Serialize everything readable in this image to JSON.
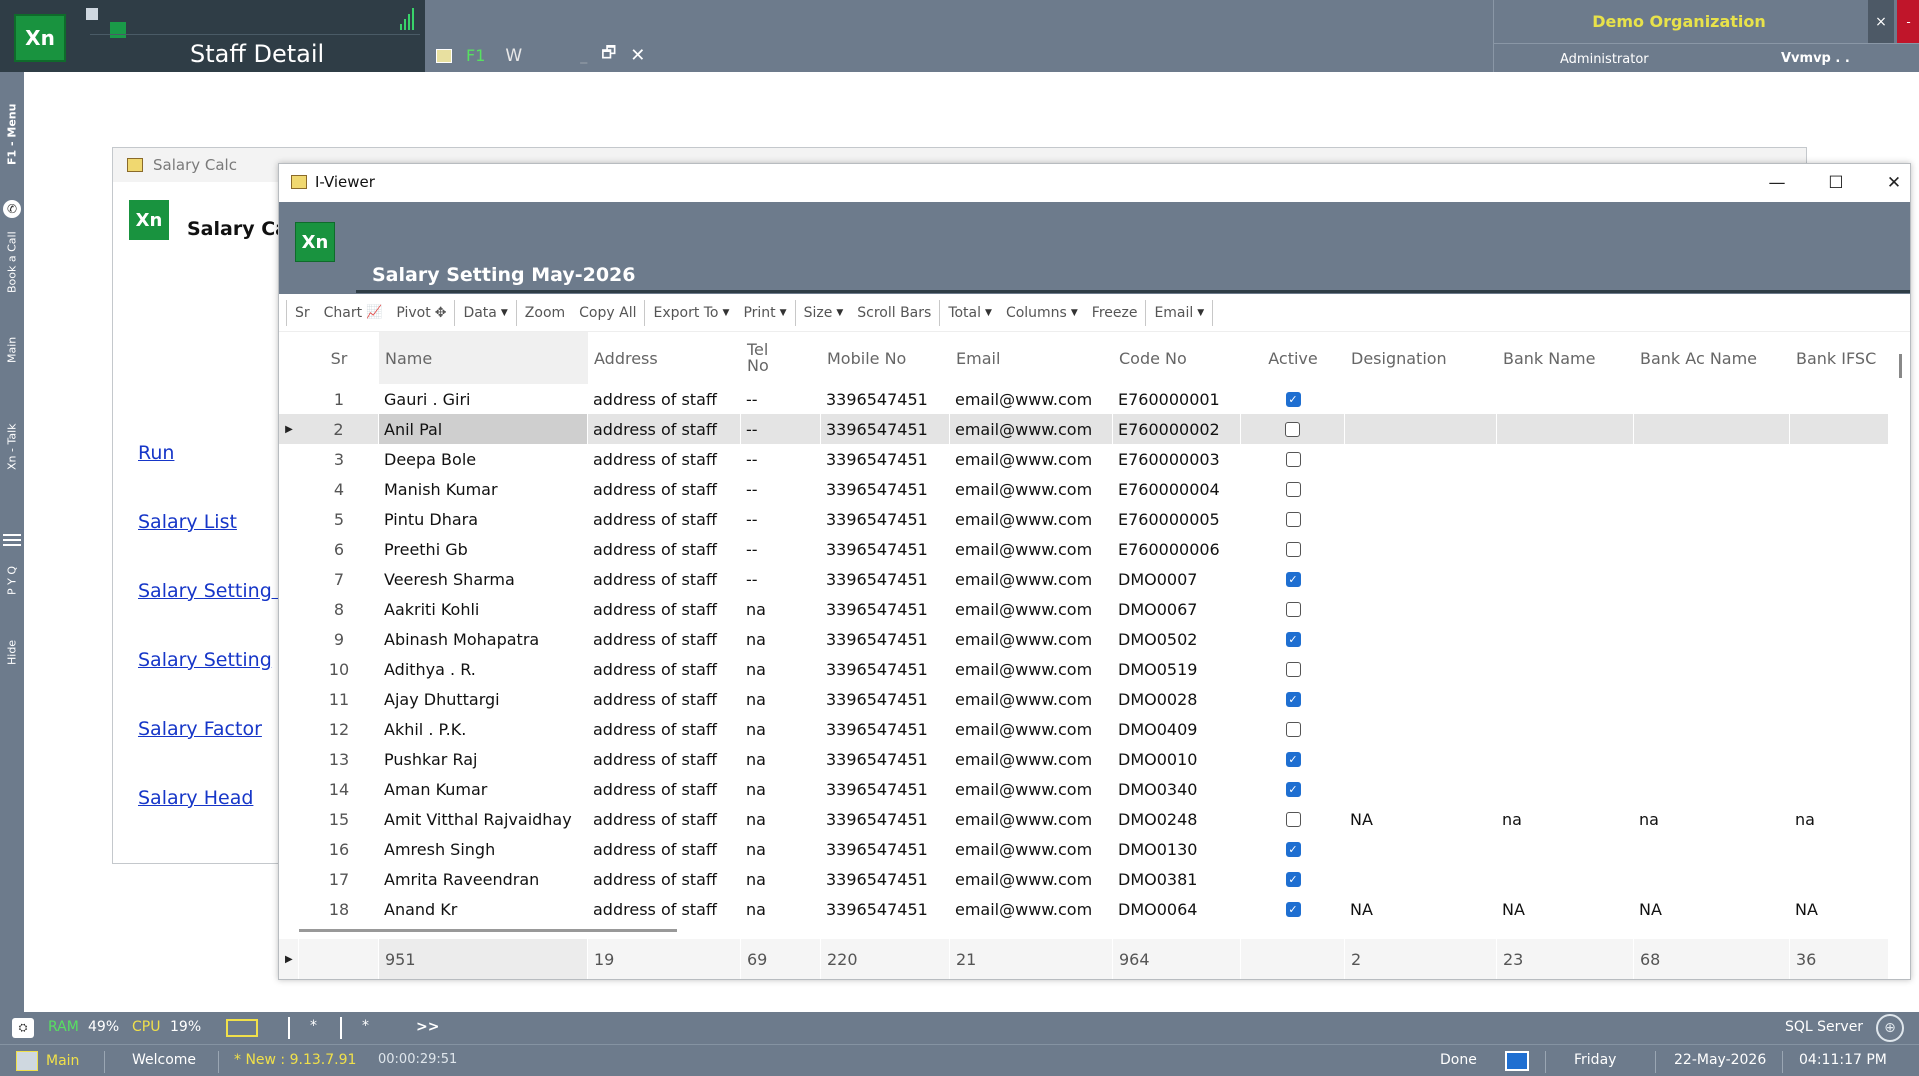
{
  "app": {
    "logo": "Xn",
    "title": "Staff Detail",
    "f1_label": "F1",
    "w_label": "W",
    "min_glyph": "_",
    "restore_glyph": "🗗",
    "close_glyph": "✕",
    "organization": "Demo Organization",
    "user_role": "Administrator",
    "user_name": "Vvmvp . .",
    "org_close": "×",
    "org_red": "-"
  },
  "left_rail": {
    "items": [
      "F1 - Menu",
      "Book a Call",
      "Main",
      "Xn - Talk",
      "P Y Q",
      "Hide"
    ]
  },
  "salary_calc": {
    "window_title": "Salary Calc",
    "logo": "Xn",
    "heading": "Salary Calc",
    "links": [
      "Run",
      "Salary List",
      "Salary Setting L",
      "Salary Setting",
      "Salary Factor",
      "Salary Head"
    ]
  },
  "viewer": {
    "window_title": "I-Viewer",
    "min_glyph": "—",
    "max_glyph": "☐",
    "close_glyph": "✕",
    "logo": "Xn",
    "heading": "Salary Setting May-2026",
    "toolbar": {
      "sr": "Sr",
      "chart": "Chart",
      "pivot": "Pivot",
      "data": "Data",
      "zoom": "Zoom",
      "copy_all": "Copy All",
      "export_to": "Export To",
      "print": "Print",
      "size": "Size",
      "scroll_bars": "Scroll Bars",
      "total": "Total",
      "columns": "Columns",
      "freeze": "Freeze",
      "email": "Email"
    },
    "columns": [
      "Sr",
      "Name",
      "Address",
      "Tel No",
      "Mobile No",
      "Email",
      "Code No",
      "Active",
      "Designation",
      "Bank Name",
      "Bank Ac Name",
      "Bank IFSC"
    ],
    "rows": [
      {
        "sr": "1",
        "name": "Gauri . Giri",
        "address": "address of staff",
        "tel": "--",
        "mobile": "3396547451",
        "email": "email@www.com",
        "code": "E760000001",
        "active": true,
        "designation": "",
        "bank": "",
        "acname": "",
        "ifsc": ""
      },
      {
        "sr": "2",
        "name": "Anil Pal",
        "address": "address of staff",
        "tel": "--",
        "mobile": "3396547451",
        "email": "email@www.com",
        "code": "E760000002",
        "active": false,
        "designation": "",
        "bank": "",
        "acname": "",
        "ifsc": ""
      },
      {
        "sr": "3",
        "name": "Deepa Bole",
        "address": "address of staff",
        "tel": "--",
        "mobile": "3396547451",
        "email": "email@www.com",
        "code": "E760000003",
        "active": false,
        "designation": "",
        "bank": "",
        "acname": "",
        "ifsc": ""
      },
      {
        "sr": "4",
        "name": "Manish Kumar",
        "address": "address of staff",
        "tel": "--",
        "mobile": "3396547451",
        "email": "email@www.com",
        "code": "E760000004",
        "active": false,
        "designation": "",
        "bank": "",
        "acname": "",
        "ifsc": ""
      },
      {
        "sr": "5",
        "name": "Pintu Dhara",
        "address": "address of staff",
        "tel": "--",
        "mobile": "3396547451",
        "email": "email@www.com",
        "code": "E760000005",
        "active": false,
        "designation": "",
        "bank": "",
        "acname": "",
        "ifsc": ""
      },
      {
        "sr": "6",
        "name": "Preethi Gb",
        "address": "address of staff",
        "tel": "--",
        "mobile": "3396547451",
        "email": "email@www.com",
        "code": "E760000006",
        "active": false,
        "designation": "",
        "bank": "",
        "acname": "",
        "ifsc": ""
      },
      {
        "sr": "7",
        "name": "Veeresh Sharma",
        "address": "address of staff",
        "tel": "--",
        "mobile": "3396547451",
        "email": "email@www.com",
        "code": "DMO0007",
        "active": true,
        "designation": "",
        "bank": "",
        "acname": "",
        "ifsc": ""
      },
      {
        "sr": "8",
        "name": "Aakriti Kohli",
        "address": "address of staff",
        "tel": "na",
        "mobile": "3396547451",
        "email": "email@www.com",
        "code": "DMO0067",
        "active": false,
        "designation": "",
        "bank": "",
        "acname": "",
        "ifsc": ""
      },
      {
        "sr": "9",
        "name": "Abinash Mohapatra",
        "address": "address of staff",
        "tel": "na",
        "mobile": "3396547451",
        "email": "email@www.com",
        "code": "DMO0502",
        "active": true,
        "designation": "",
        "bank": "",
        "acname": "",
        "ifsc": ""
      },
      {
        "sr": "10",
        "name": "Adithya . R.",
        "address": "address of staff",
        "tel": "na",
        "mobile": "3396547451",
        "email": "email@www.com",
        "code": "DMO0519",
        "active": false,
        "designation": "",
        "bank": "",
        "acname": "",
        "ifsc": ""
      },
      {
        "sr": "11",
        "name": "Ajay Dhuttargi",
        "address": "address of staff",
        "tel": "na",
        "mobile": "3396547451",
        "email": "email@www.com",
        "code": "DMO0028",
        "active": true,
        "designation": "",
        "bank": "",
        "acname": "",
        "ifsc": ""
      },
      {
        "sr": "12",
        "name": "Akhil . P.K.",
        "address": "address of staff",
        "tel": "na",
        "mobile": "3396547451",
        "email": "email@www.com",
        "code": "DMO0409",
        "active": false,
        "designation": "",
        "bank": "",
        "acname": "",
        "ifsc": ""
      },
      {
        "sr": "13",
        "name": "Pushkar Raj",
        "address": "address of staff",
        "tel": "na",
        "mobile": "3396547451",
        "email": "email@www.com",
        "code": "DMO0010",
        "active": true,
        "designation": "",
        "bank": "",
        "acname": "",
        "ifsc": ""
      },
      {
        "sr": "14",
        "name": "Aman Kumar",
        "address": "address of staff",
        "tel": "na",
        "mobile": "3396547451",
        "email": "email@www.com",
        "code": "DMO0340",
        "active": true,
        "designation": "",
        "bank": "",
        "acname": "",
        "ifsc": ""
      },
      {
        "sr": "15",
        "name": "Amit Vitthal Rajvaidhay",
        "address": "address of staff",
        "tel": "na",
        "mobile": "3396547451",
        "email": "email@www.com",
        "code": "DMO0248",
        "active": false,
        "designation": "NA",
        "bank": "na",
        "acname": "na",
        "ifsc": "na"
      },
      {
        "sr": "16",
        "name": "Amresh Singh",
        "address": "address of staff",
        "tel": "na",
        "mobile": "3396547451",
        "email": "email@www.com",
        "code": "DMO0130",
        "active": true,
        "designation": "",
        "bank": "",
        "acname": "",
        "ifsc": ""
      },
      {
        "sr": "17",
        "name": "Amrita Raveendran",
        "address": "address of staff",
        "tel": "na",
        "mobile": "3396547451",
        "email": "email@www.com",
        "code": "DMO0381",
        "active": true,
        "designation": "",
        "bank": "",
        "acname": "",
        "ifsc": ""
      },
      {
        "sr": "18",
        "name": "Anand Kr",
        "address": "address of staff",
        "tel": "na",
        "mobile": "3396547451",
        "email": "email@www.com",
        "code": "DMO0064",
        "active": true,
        "designation": "NA",
        "bank": "NA",
        "acname": "NA",
        "ifsc": "NA"
      }
    ],
    "selected_row": "2",
    "footer": {
      "name": "951",
      "address": "19",
      "tel": "69",
      "mobile": "220",
      "email": "21",
      "code": "964",
      "active": "",
      "designation": "2",
      "bank": "23",
      "acname": "68",
      "ifsc": "36"
    }
  },
  "status": {
    "ram_label": "RAM",
    "ram_value": "49%",
    "cpu_label": "CPU",
    "cpu_value": "19%",
    "star1": "*",
    "star2": "*",
    "more": ">>",
    "db": "SQL Server",
    "main_label": "Main",
    "welcome": "Welcome",
    "version": "* New : 9.13.7.91",
    "timer": "00:00:29:51",
    "state": "Done",
    "day": "Friday",
    "date": "22-May-2026",
    "time": "04:11:17 PM"
  },
  "colors": {
    "chrome": "#6d7b8c",
    "brand_green": "#19933f",
    "link_blue": "#1636c8",
    "check_blue": "#1f6fd1",
    "org_yellow": "#e8e24a"
  }
}
